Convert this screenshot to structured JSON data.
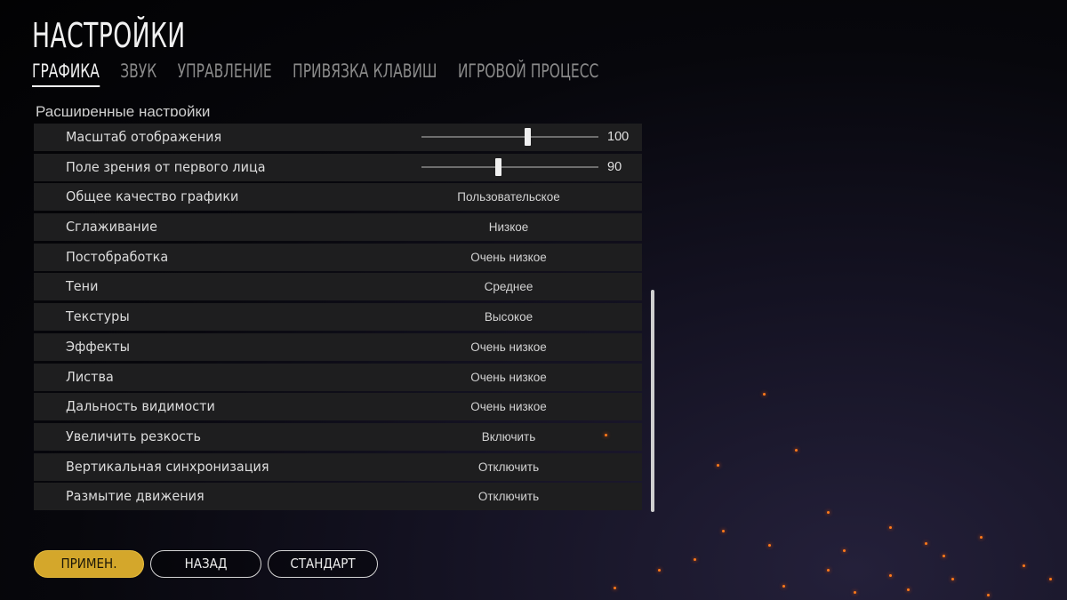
{
  "page": {
    "title": "НАСТРОЙКИ"
  },
  "tabs": [
    {
      "label": "ГРАФИКА",
      "active": true
    },
    {
      "label": "ЗВУК",
      "active": false
    },
    {
      "label": "УПРАВЛЕНИЕ",
      "active": false
    },
    {
      "label": "ПРИВЯЗКА КЛАВИШ",
      "active": false
    },
    {
      "label": "ИГРОВОЙ ПРОЦЕСС",
      "active": false
    }
  ],
  "section": {
    "header": "Расширенные настройки"
  },
  "settings": [
    {
      "label": "Масштаб отображения",
      "type": "slider",
      "value": "100",
      "fraction": 0.6
    },
    {
      "label": "Поле зрения от первого лица",
      "type": "slider",
      "value": "90",
      "fraction": 0.43
    },
    {
      "label": "Общее качество графики",
      "type": "select",
      "value": "Пользовательское"
    },
    {
      "label": "Сглаживание",
      "type": "select",
      "value": "Низкое"
    },
    {
      "label": "Постобработка",
      "type": "select",
      "value": "Очень низкое"
    },
    {
      "label": "Тени",
      "type": "select",
      "value": "Среднее"
    },
    {
      "label": "Текстуры",
      "type": "select",
      "value": "Высокое"
    },
    {
      "label": "Эффекты",
      "type": "select",
      "value": "Очень низкое"
    },
    {
      "label": "Листва",
      "type": "select",
      "value": "Очень низкое"
    },
    {
      "label": "Дальность видимости",
      "type": "select",
      "value": "Очень низкое"
    },
    {
      "label": "Увеличить резкость",
      "type": "select",
      "value": "Включить"
    },
    {
      "label": "Вертикальная синхронизация",
      "type": "select",
      "value": "Отключить"
    },
    {
      "label": "Размытие движения",
      "type": "select",
      "value": "Отключить"
    }
  ],
  "buttons": {
    "apply": "ПРИМЕН.",
    "back": "НАЗАД",
    "default": "СТАНДАРТ"
  },
  "colors": {
    "accent": "#d4a72b",
    "row_bg": "#1e1e1f",
    "spark": "#ff7a1a"
  }
}
